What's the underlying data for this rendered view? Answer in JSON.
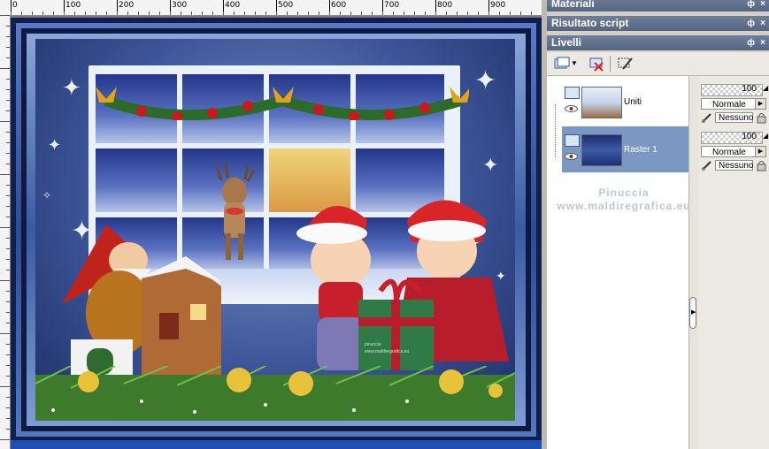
{
  "ruler": {
    "labels": [
      "0",
      "100",
      "200",
      "300",
      "400",
      "500",
      "600",
      "700",
      "800",
      "900"
    ]
  },
  "panels": {
    "materials": {
      "title": "Materiali"
    },
    "script_output": {
      "title": "Risultato script"
    },
    "layers": {
      "title": "Livelli",
      "toolbar_icons": [
        "new-layer-icon",
        "dropdown-arrow-icon",
        "delete-layer-icon",
        "properties-icon"
      ],
      "items": [
        {
          "name": "Uniti",
          "selected": false,
          "opacity": "100",
          "blend_mode": "Normale",
          "mask": "Nessuno"
        },
        {
          "name": "Raster 1",
          "selected": true,
          "opacity": "100",
          "blend_mode": "Normale",
          "mask": "Nessuno"
        }
      ]
    }
  },
  "watermark": {
    "line1": "Pinuccia",
    "line2": "www.maldiregrafica.eu"
  },
  "image_signature": {
    "line1": "pinuccia",
    "line2": "www.maldiregrafica.eu"
  },
  "colors": {
    "panel_header": "#5f6f8c",
    "selected_layer": "#7b97c4",
    "frame_dark": "#0f1f4f",
    "frame_mid": "#3c5aa2"
  }
}
